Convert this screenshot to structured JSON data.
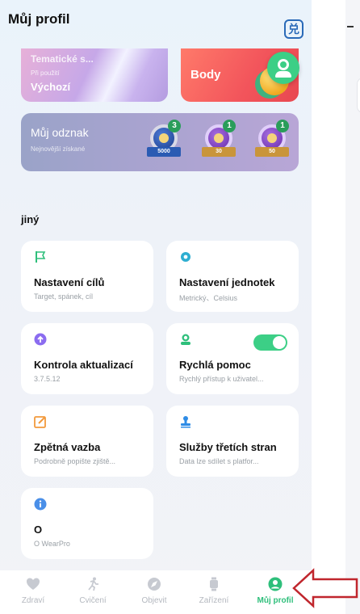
{
  "header": {
    "title": "Můj profil",
    "exchange_icon": "exchange-icon"
  },
  "top_cards": {
    "theme": {
      "title": "Tematické s...",
      "caption": "Při použití",
      "value": "Výchozí"
    },
    "body": {
      "label": "Body"
    }
  },
  "badges": {
    "title": "Můj odznak",
    "subtitle": "Nejnovější získané",
    "items": [
      {
        "ribbon": "5000",
        "count": "3"
      },
      {
        "ribbon": "30",
        "count": "1"
      },
      {
        "ribbon": "50",
        "count": "1"
      }
    ]
  },
  "section": {
    "title": "jiný"
  },
  "tiles": [
    {
      "name": "Nastavení cílů",
      "sub": "Target, spánek, cíl",
      "icon": "flag-icon"
    },
    {
      "name": "Nastavení jednotek",
      "sub": "Metrický、Celsius",
      "icon": "gear-icon"
    },
    {
      "name": "Kontrola aktualizací",
      "sub": "3.7.5.12",
      "icon": "update-icon"
    },
    {
      "name": "Rychlá pomoc",
      "sub": "Rychlý přístup k uživatel...",
      "icon": "help-icon",
      "toggle_on": true
    },
    {
      "name": "Zpětná vazba",
      "sub": "Podrobně popište zjiště...",
      "icon": "edit-icon"
    },
    {
      "name": "Služby třetích stran",
      "sub": "Data lze sdílet s platfor...",
      "icon": "stamp-icon"
    },
    {
      "name": "O",
      "sub": "O WearPro",
      "icon": "info-icon"
    }
  ],
  "nav": {
    "items": [
      {
        "label": "Zdraví",
        "icon": "heart-icon"
      },
      {
        "label": "Cvičení",
        "icon": "runner-icon"
      },
      {
        "label": "Objevit",
        "icon": "compass-icon"
      },
      {
        "label": "Zařízení",
        "icon": "watch-icon"
      },
      {
        "label": "Můj profil",
        "icon": "profile-icon"
      }
    ],
    "active_index": 4
  },
  "colors": {
    "accent": "#2ebf7b",
    "annotation": "#c0262d",
    "primary_blue": "#2a6ab8"
  }
}
